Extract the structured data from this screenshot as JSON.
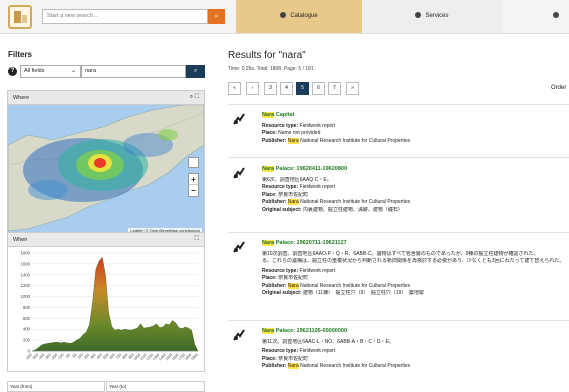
{
  "header": {
    "search_placeholder": "Start a new search...",
    "tabs": [
      {
        "label": "Catalogue",
        "icon": "catalogue-icon"
      },
      {
        "label": "Services",
        "icon": "gear-icon"
      },
      {
        "label": "",
        "icon": "info-icon"
      }
    ]
  },
  "filters": {
    "title": "Filters",
    "field_select": "All fields",
    "query": "nara",
    "where_label": "Where",
    "map_attribution": "Leaflet | © OpenStreetMap contributors",
    "when_label": "When",
    "year_from_label": "Year (from)",
    "year_to_label": "Year (to)"
  },
  "colors": {
    "accent": "#e37222",
    "brand": "#e9c98a",
    "dark": "#1c3d5a",
    "link": "#1e7a1e"
  },
  "results": {
    "title": "Results for \"nara\"",
    "stats": "Time: 0.26s. Total: 1808. Page: 5 / 181",
    "order_label": "Order",
    "pager": [
      "«",
      "‹",
      "3",
      "4",
      "5",
      "6",
      "7",
      "»"
    ],
    "active_page": "5",
    "items": [
      {
        "title_hl": "Nara",
        "title_rest": " Capital",
        "desc": "",
        "resource_type": "Fieldwork report",
        "place": "Name not provided",
        "publisher_hl": "Nara",
        "publisher_rest": " National Research Institute for Cultural Properties",
        "original_subject": ""
      },
      {
        "title_hl": "Nara",
        "title_rest": " Palace: 19620411-19620800",
        "desc": "第6次、調査地区6AAQ-C・E。",
        "resource_type": "Fieldwork report",
        "place": "奈良市佐紀町",
        "publisher_hl": "Nara",
        "publisher_rest": " National Research Institute for Cultural Properties",
        "original_subject": "内裏建物、掘立柱建物、溝跡、建物（礎石）"
      },
      {
        "title_hl": "Nara",
        "title_rest": " Palace: 19620711-19621127",
        "desc": "第10次調査。調査地区6AAO-P・Q・R、6ABB-C。遺物はすべて包含層のものであったが、9棟の掘立柱建物が確認された。",
        "desc2": "る。これらの遺構は、掘立柱の重複状況から判断される新旧関係を再検討する必要があり、少なくとも3回にわたって建て替えられた。",
        "resource_type": "Fieldwork report",
        "place": "奈良市佐紀町",
        "publisher_hl": "Nara",
        "publisher_rest": " National Research Institute for Cultural Properties",
        "original_subject": "建物（11棟）　掘立柱穴（9）　掘立柱穴（19）　築地塀"
      },
      {
        "title_hl": "Nara",
        "title_rest": " Palace: 19621105-00000000",
        "desc": "第11次。調査地区6AAC-L・NO、6ABB-A・B・C・D・E。",
        "resource_type": "Fieldwork report",
        "place": "奈良市佐紀町",
        "publisher_hl": "Nara",
        "publisher_rest": " National Research Institute for Cultural Properties",
        "original_subject": ""
      }
    ]
  },
  "labels": {
    "resource_type": "Resource type: ",
    "place": "Place: ",
    "publisher": "Publisher: ",
    "original_subject": "Original subject: "
  },
  "chart_data": {
    "type": "area",
    "title": "",
    "xlabel": "",
    "ylabel": "",
    "ylim": [
      0,
      1800
    ],
    "y_ticks": [
      0,
      200,
      400,
      600,
      800,
      1000,
      1200,
      1400,
      1600,
      1800
    ],
    "x_ticks": [
      "-650",
      "-550",
      "-450",
      "-350",
      "-250",
      "-150",
      "-50",
      "50",
      "150",
      "250",
      "350",
      "450",
      "550",
      "650",
      "750",
      "850",
      "950",
      "1050",
      "1150",
      "1250",
      "1350",
      "1450",
      "1550",
      "1650",
      "1750",
      "1850",
      "1950"
    ],
    "x": [
      -650,
      -600,
      -550,
      -500,
      -450,
      -400,
      -350,
      -300,
      -250,
      -200,
      -150,
      -100,
      -50,
      0,
      50,
      100,
      150,
      200,
      250,
      300,
      350,
      400,
      450,
      500,
      550,
      600,
      650,
      700,
      750,
      800,
      850,
      900,
      950,
      1000,
      1050,
      1100,
      1150,
      1200,
      1250,
      1300,
      1350,
      1400,
      1450,
      1500,
      1550,
      1600,
      1650,
      1700,
      1750,
      1800,
      1850,
      1900,
      1950
    ],
    "values": [
      0,
      20,
      60,
      110,
      130,
      140,
      150,
      160,
      160,
      150,
      160,
      150,
      140,
      160,
      200,
      230,
      300,
      350,
      480,
      900,
      1500,
      1650,
      1720,
      1400,
      700,
      450,
      380,
      400,
      380,
      400,
      390,
      380,
      400,
      420,
      500,
      420,
      430,
      440,
      460,
      500,
      430,
      440,
      500,
      480,
      560,
      520,
      430,
      410,
      440,
      420,
      380,
      120,
      0
    ]
  }
}
